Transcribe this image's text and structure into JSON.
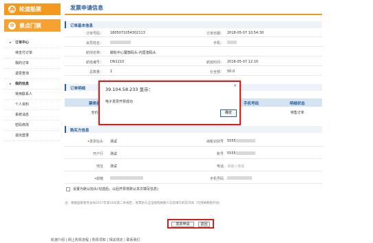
{
  "sidebar": {
    "nav1": "轮渡船票",
    "nav2": "景点门票",
    "menu": [
      {
        "label": "订单中心",
        "head": true
      },
      {
        "label": "待支付订单"
      },
      {
        "label": "我的订单"
      },
      {
        "label": "退票查询"
      },
      {
        "label": "我的信息",
        "head": true
      },
      {
        "label": "常用联系人"
      },
      {
        "label": "个人资料"
      },
      {
        "label": "系统消息"
      },
      {
        "label": "密码修改"
      },
      {
        "label": "退出登录"
      }
    ]
  },
  "page": {
    "title": "发票申请信息"
  },
  "order": {
    "section": "订单基本信息",
    "order_no_label": "订单号码：",
    "order_no": "1805071054302113",
    "order_date_label": "订单日期：",
    "order_date": "2018-05-07 10:54:30",
    "member_label": "会员姓名：",
    "phone_label": "手机：",
    "route_label": "航线名称：",
    "route": "邮轮中心厦鼓码头-内厝澳码头",
    "flight_label": "航班编号：",
    "flight": "DN1210",
    "time_label": "航班时间：",
    "time": "2018-05-07 12:10",
    "count_label": "总数量：",
    "count": "1",
    "price_label": "价全部：",
    "price": "50.0"
  },
  "details": {
    "section": "订单明细",
    "cols": [
      "票类名称",
      "手机号码",
      "明细状态"
    ],
    "row": [
      "全价票",
      "",
      "待售订单"
    ]
  },
  "buyer": {
    "section": "购买方信息",
    "title_label": "发票抬头",
    "title_val": "测试",
    "taxid_label": "纳税识别号",
    "taxid_prefix": "5555",
    "bank_label": "开户行",
    "bank_val": "测试",
    "account_label": "账号",
    "account_prefix": "5555",
    "address_label": "地址",
    "address_val": "测试",
    "tel_label": "电话",
    "tel_placeholder": "请输入电话",
    "email_label": "邮箱",
    "mobile_label": "手机号码"
  },
  "default_check": "设置为默认抬头(勾选后，以后开票将默认本次填写信息)",
  "note": "注：根据国家税务总局2017年第16号第二条规定，发票抬头应当按照纳税人信息填写如实开具（仅限纳税税开具）",
  "buttons": {
    "submit": "发票申请",
    "back": "返回"
  },
  "footer": "轮渡介绍  |  网上购票流程  |  购票须知  |  相关规定  |  联系我们",
  "dialog": {
    "title": "39.104.58.233 显示：",
    "message": "电子发票开票成功",
    "ok": "确定",
    "close": "×"
  }
}
